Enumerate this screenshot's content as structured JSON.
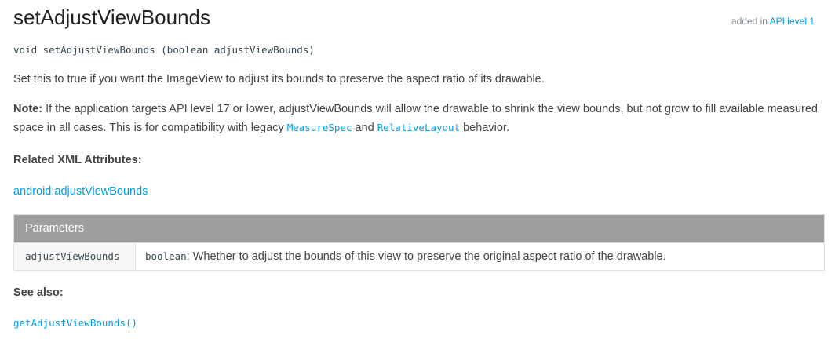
{
  "method": {
    "title": "setAdjustViewBounds",
    "added_prefix": "added in ",
    "added_link": "API level 1",
    "signature": "void setAdjustViewBounds (boolean adjustViewBounds)",
    "description": "Set this to true if you want the ImageView to adjust its bounds to preserve the aspect ratio of its drawable."
  },
  "note": {
    "label": "Note:",
    "text_1": " If the application targets API level 17 or lower, adjustViewBounds will allow the drawable to shrink the view bounds, but not grow to fill available measured space in all cases. This is for compatibility with legacy ",
    "link_1": "MeasureSpec",
    "text_2": " and ",
    "link_2": "RelativeLayout",
    "text_3": " behavior."
  },
  "related": {
    "heading": "Related XML Attributes:",
    "attr_link": "android:adjustViewBounds"
  },
  "parameters": {
    "heading": "Parameters",
    "rows": [
      {
        "name": "adjustViewBounds",
        "type": "boolean",
        "description": ": Whether to adjust the bounds of this view to preserve the original aspect ratio of the drawable."
      }
    ]
  },
  "see_also": {
    "heading": "See also:",
    "link": "getAdjustViewBounds()"
  },
  "colors": {
    "link": "#039be5",
    "table_header_bg": "#9e9e9e",
    "text": "#444444"
  }
}
